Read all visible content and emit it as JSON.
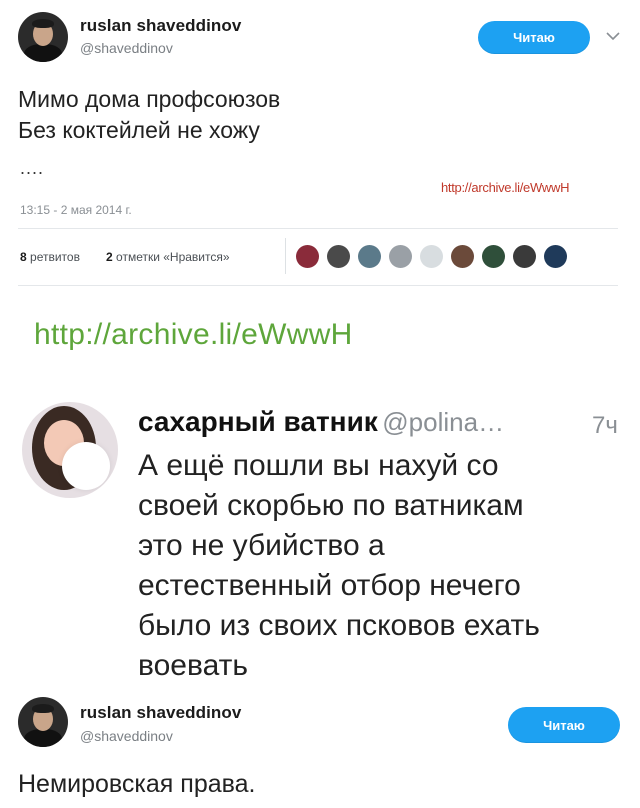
{
  "tweet1": {
    "username": "ruslan shaveddinov",
    "handle": "@shaveddinov",
    "follow_label": "Читаю",
    "chevron": "chevron-down-icon",
    "text": "Мимо дома профсоюзов\nБез коктейлей не хожу",
    "dots": "....",
    "timestamp": "13:15 - 2 мая 2014 г.",
    "archive_link": "http://archive.li/eWwwH",
    "retweets_count": "8",
    "retweets_label": "ретвитов",
    "likes_count": "2",
    "likes_label": "отметки «Нравится»",
    "liker_colors": [
      "#8a2b3a",
      "#4a4a4a",
      "#5b7a8a",
      "#9aa0a6",
      "#d8dde0",
      "#6b4a3a",
      "#2f4f3a",
      "#3a3a3a",
      "#1f3a5a"
    ]
  },
  "archive_link_big": "http://archive.li/eWwwH",
  "tweet2": {
    "name": "сахарный ватник",
    "handle": "@polina…",
    "time": "7ч",
    "text": "А ещё пошли вы нахуй со\nсвоей скорбью по ватникам\nэто не убийство а\nестественный отбор нечего\nбыло из своих псковов ехать\nвоевать"
  },
  "tweet3": {
    "username": "ruslan shaveddinov",
    "handle": "@shaveddinov",
    "follow_label": "Читаю",
    "text": "Немировская права."
  },
  "colors": {
    "accent": "#1da1f2",
    "link_green": "#5ea63b",
    "link_red": "#c0392b"
  }
}
